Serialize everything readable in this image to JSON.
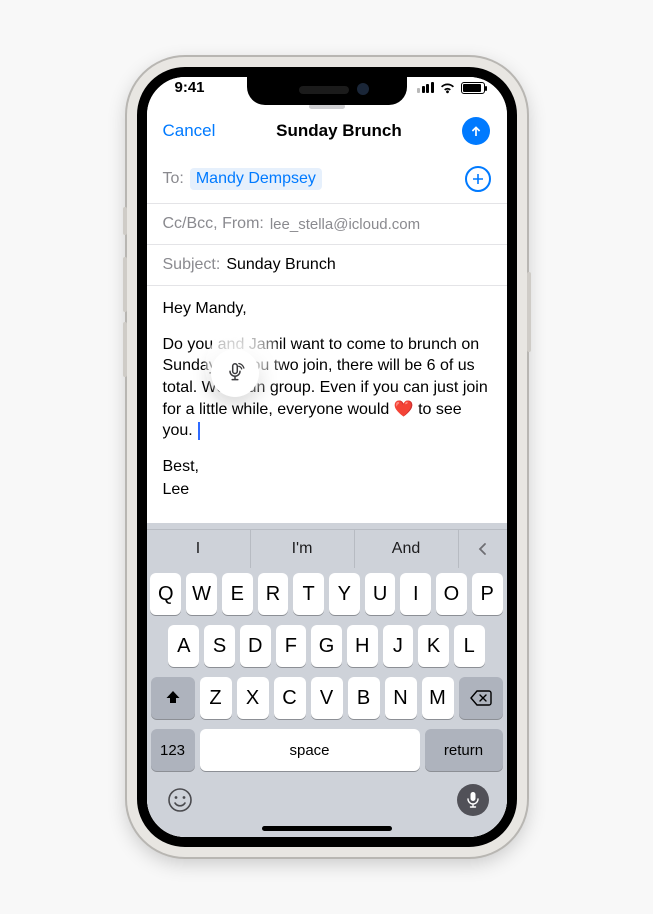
{
  "statusbar": {
    "time": "9:41"
  },
  "compose": {
    "cancel_label": "Cancel",
    "title": "Sunday Brunch",
    "to_label": "To:",
    "recipient": "Mandy Dempsey",
    "ccbcc_label": "Cc/Bcc, From:",
    "from_email": "lee_stella@icloud.com",
    "subject_label": "Subject:",
    "subject_value": "Sunday Brunch",
    "body_greeting": "Hey Mandy,",
    "body_p1_a": "Do you and Jamil want to come to brunch on Sunday? If you two join, there will be 6 of us total. Wo",
    "body_p1_b": " a fun group. Even if you can just join for a little while, everyone would ",
    "body_p1_c": " to see you. ",
    "sig_best": "Best,",
    "sig_name": "Lee"
  },
  "predictions": {
    "p1": "I",
    "p2": "I'm",
    "p3": "And"
  },
  "keys": {
    "row1": [
      "Q",
      "W",
      "E",
      "R",
      "T",
      "Y",
      "U",
      "I",
      "O",
      "P"
    ],
    "row2": [
      "A",
      "S",
      "D",
      "F",
      "G",
      "H",
      "J",
      "K",
      "L"
    ],
    "row3": [
      "Z",
      "X",
      "C",
      "V",
      "B",
      "N",
      "M"
    ],
    "num": "123",
    "space": "space",
    "return": "return"
  }
}
